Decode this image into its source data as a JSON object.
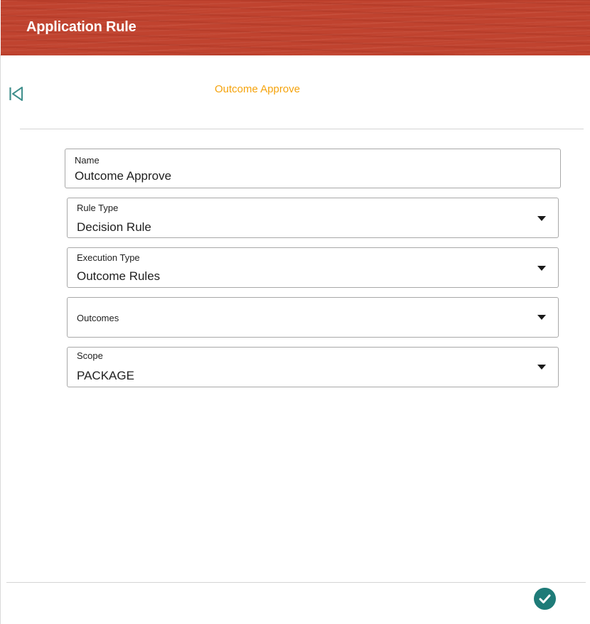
{
  "header": {
    "title": "Application Rule",
    "bg_color": "#c0432f"
  },
  "toolbar": {
    "back_icon": "skip-to-first-icon",
    "subtitle": "Outcome Approve",
    "subtitle_color": "#f5a30c"
  },
  "form": {
    "name": {
      "label": "Name",
      "value": "Outcome Approve"
    },
    "rule_type": {
      "label": "Rule Type",
      "value": "Decision Rule"
    },
    "execution_type": {
      "label": "Execution Type",
      "value": "Outcome Rules"
    },
    "outcomes": {
      "label": "Outcomes",
      "value": ""
    },
    "scope": {
      "label": "Scope",
      "value": "PACKAGE"
    }
  },
  "footer": {
    "confirm_icon": "check-circle-icon",
    "confirm_color": "#1e7b78"
  }
}
